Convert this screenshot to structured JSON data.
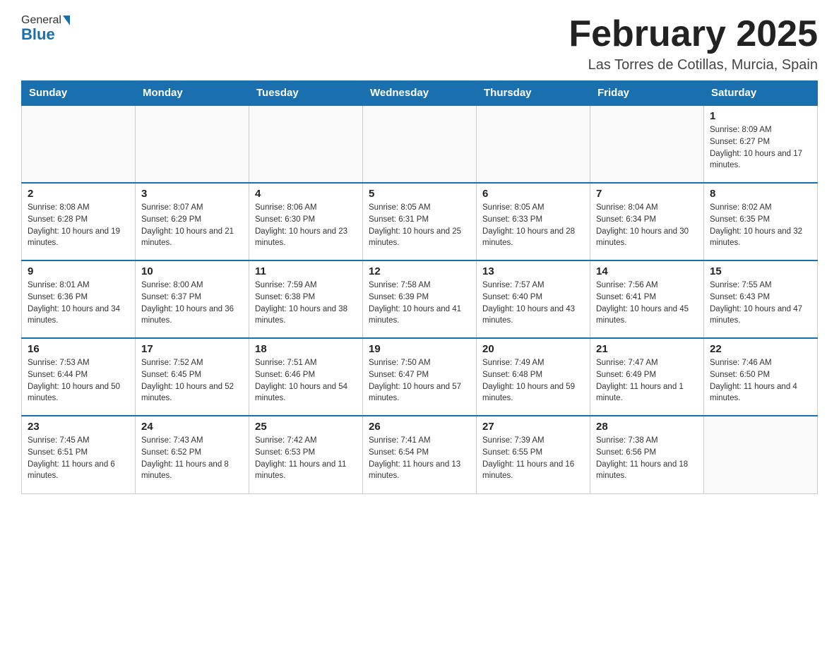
{
  "header": {
    "logo": {
      "general": "General",
      "blue": "Blue",
      "arrow_alt": "blue arrow"
    },
    "title": "February 2025",
    "location": "Las Torres de Cotillas, Murcia, Spain"
  },
  "weekdays": [
    "Sunday",
    "Monday",
    "Tuesday",
    "Wednesday",
    "Thursday",
    "Friday",
    "Saturday"
  ],
  "weeks": [
    [
      {
        "day": "",
        "sunrise": "",
        "sunset": "",
        "daylight": ""
      },
      {
        "day": "",
        "sunrise": "",
        "sunset": "",
        "daylight": ""
      },
      {
        "day": "",
        "sunrise": "",
        "sunset": "",
        "daylight": ""
      },
      {
        "day": "",
        "sunrise": "",
        "sunset": "",
        "daylight": ""
      },
      {
        "day": "",
        "sunrise": "",
        "sunset": "",
        "daylight": ""
      },
      {
        "day": "",
        "sunrise": "",
        "sunset": "",
        "daylight": ""
      },
      {
        "day": "1",
        "sunrise": "Sunrise: 8:09 AM",
        "sunset": "Sunset: 6:27 PM",
        "daylight": "Daylight: 10 hours and 17 minutes."
      }
    ],
    [
      {
        "day": "2",
        "sunrise": "Sunrise: 8:08 AM",
        "sunset": "Sunset: 6:28 PM",
        "daylight": "Daylight: 10 hours and 19 minutes."
      },
      {
        "day": "3",
        "sunrise": "Sunrise: 8:07 AM",
        "sunset": "Sunset: 6:29 PM",
        "daylight": "Daylight: 10 hours and 21 minutes."
      },
      {
        "day": "4",
        "sunrise": "Sunrise: 8:06 AM",
        "sunset": "Sunset: 6:30 PM",
        "daylight": "Daylight: 10 hours and 23 minutes."
      },
      {
        "day": "5",
        "sunrise": "Sunrise: 8:05 AM",
        "sunset": "Sunset: 6:31 PM",
        "daylight": "Daylight: 10 hours and 25 minutes."
      },
      {
        "day": "6",
        "sunrise": "Sunrise: 8:05 AM",
        "sunset": "Sunset: 6:33 PM",
        "daylight": "Daylight: 10 hours and 28 minutes."
      },
      {
        "day": "7",
        "sunrise": "Sunrise: 8:04 AM",
        "sunset": "Sunset: 6:34 PM",
        "daylight": "Daylight: 10 hours and 30 minutes."
      },
      {
        "day": "8",
        "sunrise": "Sunrise: 8:02 AM",
        "sunset": "Sunset: 6:35 PM",
        "daylight": "Daylight: 10 hours and 32 minutes."
      }
    ],
    [
      {
        "day": "9",
        "sunrise": "Sunrise: 8:01 AM",
        "sunset": "Sunset: 6:36 PM",
        "daylight": "Daylight: 10 hours and 34 minutes."
      },
      {
        "day": "10",
        "sunrise": "Sunrise: 8:00 AM",
        "sunset": "Sunset: 6:37 PM",
        "daylight": "Daylight: 10 hours and 36 minutes."
      },
      {
        "day": "11",
        "sunrise": "Sunrise: 7:59 AM",
        "sunset": "Sunset: 6:38 PM",
        "daylight": "Daylight: 10 hours and 38 minutes."
      },
      {
        "day": "12",
        "sunrise": "Sunrise: 7:58 AM",
        "sunset": "Sunset: 6:39 PM",
        "daylight": "Daylight: 10 hours and 41 minutes."
      },
      {
        "day": "13",
        "sunrise": "Sunrise: 7:57 AM",
        "sunset": "Sunset: 6:40 PM",
        "daylight": "Daylight: 10 hours and 43 minutes."
      },
      {
        "day": "14",
        "sunrise": "Sunrise: 7:56 AM",
        "sunset": "Sunset: 6:41 PM",
        "daylight": "Daylight: 10 hours and 45 minutes."
      },
      {
        "day": "15",
        "sunrise": "Sunrise: 7:55 AM",
        "sunset": "Sunset: 6:43 PM",
        "daylight": "Daylight: 10 hours and 47 minutes."
      }
    ],
    [
      {
        "day": "16",
        "sunrise": "Sunrise: 7:53 AM",
        "sunset": "Sunset: 6:44 PM",
        "daylight": "Daylight: 10 hours and 50 minutes."
      },
      {
        "day": "17",
        "sunrise": "Sunrise: 7:52 AM",
        "sunset": "Sunset: 6:45 PM",
        "daylight": "Daylight: 10 hours and 52 minutes."
      },
      {
        "day": "18",
        "sunrise": "Sunrise: 7:51 AM",
        "sunset": "Sunset: 6:46 PM",
        "daylight": "Daylight: 10 hours and 54 minutes."
      },
      {
        "day": "19",
        "sunrise": "Sunrise: 7:50 AM",
        "sunset": "Sunset: 6:47 PM",
        "daylight": "Daylight: 10 hours and 57 minutes."
      },
      {
        "day": "20",
        "sunrise": "Sunrise: 7:49 AM",
        "sunset": "Sunset: 6:48 PM",
        "daylight": "Daylight: 10 hours and 59 minutes."
      },
      {
        "day": "21",
        "sunrise": "Sunrise: 7:47 AM",
        "sunset": "Sunset: 6:49 PM",
        "daylight": "Daylight: 11 hours and 1 minute."
      },
      {
        "day": "22",
        "sunrise": "Sunrise: 7:46 AM",
        "sunset": "Sunset: 6:50 PM",
        "daylight": "Daylight: 11 hours and 4 minutes."
      }
    ],
    [
      {
        "day": "23",
        "sunrise": "Sunrise: 7:45 AM",
        "sunset": "Sunset: 6:51 PM",
        "daylight": "Daylight: 11 hours and 6 minutes."
      },
      {
        "day": "24",
        "sunrise": "Sunrise: 7:43 AM",
        "sunset": "Sunset: 6:52 PM",
        "daylight": "Daylight: 11 hours and 8 minutes."
      },
      {
        "day": "25",
        "sunrise": "Sunrise: 7:42 AM",
        "sunset": "Sunset: 6:53 PM",
        "daylight": "Daylight: 11 hours and 11 minutes."
      },
      {
        "day": "26",
        "sunrise": "Sunrise: 7:41 AM",
        "sunset": "Sunset: 6:54 PM",
        "daylight": "Daylight: 11 hours and 13 minutes."
      },
      {
        "day": "27",
        "sunrise": "Sunrise: 7:39 AM",
        "sunset": "Sunset: 6:55 PM",
        "daylight": "Daylight: 11 hours and 16 minutes."
      },
      {
        "day": "28",
        "sunrise": "Sunrise: 7:38 AM",
        "sunset": "Sunset: 6:56 PM",
        "daylight": "Daylight: 11 hours and 18 minutes."
      },
      {
        "day": "",
        "sunrise": "",
        "sunset": "",
        "daylight": ""
      }
    ]
  ]
}
